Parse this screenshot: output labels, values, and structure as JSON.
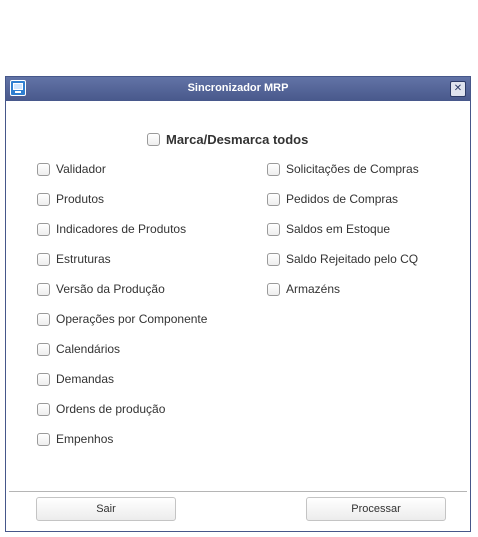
{
  "window": {
    "title": "Sincronizador MRP",
    "close_glyph": "✕"
  },
  "toggle_all": {
    "label": "Marca/Desmarca todos",
    "checked": false
  },
  "left_options": [
    {
      "label": "Validador",
      "checked": false
    },
    {
      "label": "Produtos",
      "checked": false
    },
    {
      "label": "Indicadores de Produtos",
      "checked": false
    },
    {
      "label": "Estruturas",
      "checked": false
    },
    {
      "label": "Versão da Produção",
      "checked": false
    },
    {
      "label": "Operações por Componente",
      "checked": false
    },
    {
      "label": "Calendários",
      "checked": false
    },
    {
      "label": "Demandas",
      "checked": false
    },
    {
      "label": "Ordens de produção",
      "checked": false
    },
    {
      "label": "Empenhos",
      "checked": false
    }
  ],
  "right_options": [
    {
      "label": "Solicitações de Compras",
      "checked": false
    },
    {
      "label": "Pedidos de Compras",
      "checked": false
    },
    {
      "label": "Saldos em Estoque",
      "checked": false
    },
    {
      "label": "Saldo Rejeitado pelo CQ",
      "checked": false
    },
    {
      "label": "Armazéns",
      "checked": false
    }
  ],
  "buttons": {
    "exit_label": "Sair",
    "process_label": "Processar"
  },
  "colors": {
    "titlebar": "#4f5f93",
    "window_border": "#46578a",
    "app_icon": "#2f7fd0"
  },
  "icons": {
    "app": "app-window-icon",
    "close": "close-icon"
  }
}
